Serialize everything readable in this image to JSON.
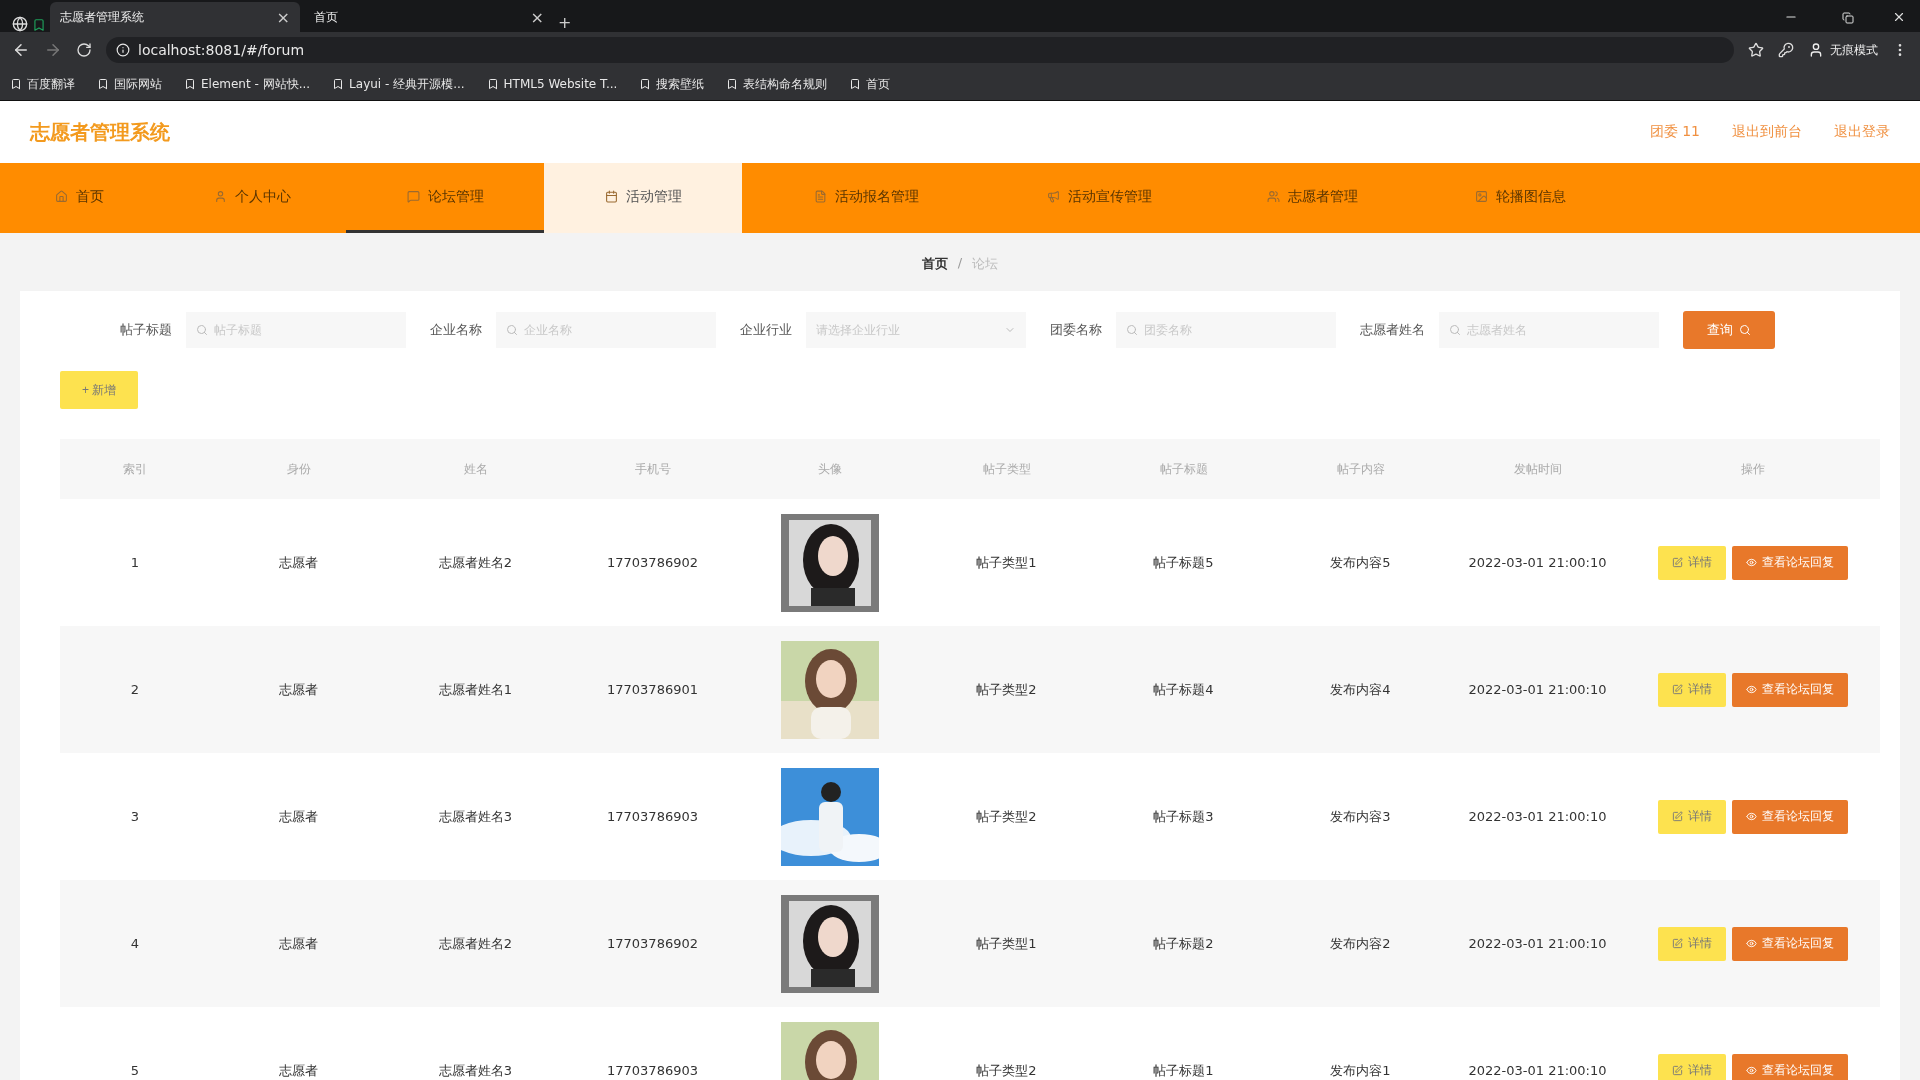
{
  "browser": {
    "tabs": [
      {
        "title": "志愿者管理系统",
        "selected": true,
        "close": "×"
      },
      {
        "title": "首页",
        "selected": false,
        "close": "×"
      }
    ],
    "new_tab": "+",
    "url": "localhost:8081/#/forum",
    "profile": "无痕模式",
    "bookmarks": [
      "百度翻译",
      "国际网站",
      "Element - 网站快...",
      "Layui - 经典开源模...",
      "HTML5 Website T...",
      "搜索壁纸",
      "表结构命名规则",
      "首页"
    ]
  },
  "header": {
    "title": "志愿者管理系统",
    "links": [
      "团委 11",
      "退出到前台",
      "退出登录"
    ]
  },
  "nav": [
    {
      "label": "首页",
      "selected": false,
      "hovered": false
    },
    {
      "label": "个人中心",
      "selected": false,
      "hovered": false
    },
    {
      "label": "论坛管理",
      "selected": true,
      "hovered": false
    },
    {
      "label": "活动管理",
      "selected": false,
      "hovered": true
    },
    {
      "label": "活动报名管理",
      "selected": false,
      "hovered": false
    },
    {
      "label": "活动宣传管理",
      "selected": false,
      "hovered": false
    },
    {
      "label": "志愿者管理",
      "selected": false,
      "hovered": false
    },
    {
      "label": "轮播图信息",
      "selected": false,
      "hovered": false
    }
  ],
  "breadcrumb": [
    "首页",
    "论坛"
  ],
  "breadcrumb_separator": "/",
  "search": {
    "fields": [
      {
        "kind": "input",
        "label": "帖子标题",
        "placeholder": "帖子标题"
      },
      {
        "kind": "input",
        "label": "企业名称",
        "placeholder": "企业名称"
      },
      {
        "kind": "select",
        "label": "企业行业",
        "placeholder": "请选择企业行业"
      },
      {
        "kind": "input",
        "label": "团委名称",
        "placeholder": "团委名称"
      },
      {
        "kind": "input",
        "label": "志愿者姓名",
        "placeholder": "志愿者姓名"
      }
    ],
    "button": "查询"
  },
  "add_button": "+ 新增",
  "table": {
    "columns": [
      "索引",
      "身份",
      "姓名",
      "手机号",
      "头像",
      "帖子类型",
      "帖子标题",
      "帖子内容",
      "发帖时间",
      "操作"
    ],
    "rows": [
      {
        "cells": [
          "1",
          "志愿者",
          "志愿者姓名2",
          "17703786902"
        ],
        "avatar": {
          "kind": "picture"
        },
        "rest": [
          "帖子类型1",
          "帖子标题5",
          "发布内容5",
          "2022-03-01 21:00:10"
        ],
        "actions": [
          "详情",
          "查看论坛回复"
        ]
      },
      {
        "cells": [
          "2",
          "志愿者",
          "志愿者姓名1",
          "17703786901"
        ],
        "avatar": {
          "kind": "picture"
        },
        "rest": [
          "帖子类型2",
          "帖子标题4",
          "发布内容4",
          "2022-03-01 21:00:10"
        ],
        "actions": [
          "详情",
          "查看论坛回复"
        ]
      },
      {
        "cells": [
          "3",
          "志愿者",
          "志愿者姓名3",
          "17703786903"
        ],
        "avatar": {
          "kind": "picture"
        },
        "rest": [
          "帖子类型2",
          "帖子标题3",
          "发布内容3",
          "2022-03-01 21:00:10"
        ],
        "actions": [
          "详情",
          "查看论坛回复"
        ]
      },
      {
        "cells": [
          "4",
          "志愿者",
          "志愿者姓名2",
          "17703786902"
        ],
        "avatar": {
          "kind": "picture"
        },
        "rest": [
          "帖子类型1",
          "帖子标题2",
          "发布内容2",
          "2022-03-01 21:00:10"
        ],
        "actions": [
          "详情",
          "查看论坛回复"
        ]
      },
      {
        "cells": [
          "5",
          "志愿者",
          "志愿者姓名3",
          "17703786903"
        ],
        "avatar": {
          "kind": "picture"
        },
        "rest": [
          "帖子类型2",
          "帖子标题1",
          "发布内容1",
          "2022-03-01 21:00:10"
        ],
        "actions": [
          "详情",
          "查看论坛回复"
        ]
      }
    ]
  }
}
